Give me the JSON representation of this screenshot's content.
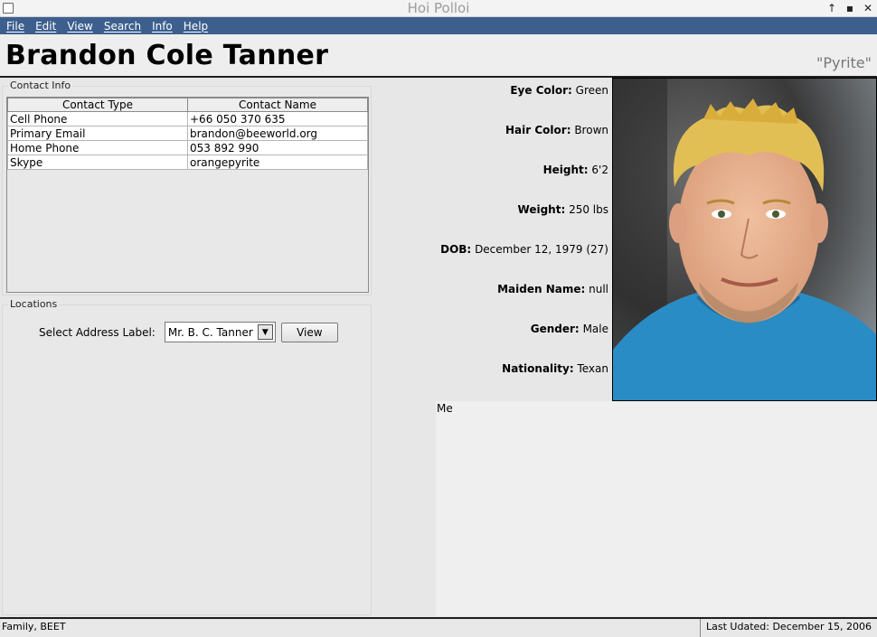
{
  "window": {
    "title": "Hoi Polloi",
    "controls": [
      "↑",
      "▪",
      "✕"
    ]
  },
  "menu": [
    "File",
    "Edit",
    "View",
    "Search",
    "Info",
    "Help"
  ],
  "header": {
    "name": "Brandon Cole Tanner",
    "nickname": "\"Pyrite\""
  },
  "contact_panel": {
    "legend": "Contact Info",
    "columns": [
      "Contact Type",
      "Contact Name"
    ],
    "rows": [
      [
        "Cell Phone",
        "+66 050 370 635"
      ],
      [
        "Primary Email",
        "brandon@beeworld.org"
      ],
      [
        "Home Phone",
        "053 892 990"
      ],
      [
        "Skype",
        "orangepyrite"
      ]
    ]
  },
  "locations_panel": {
    "legend": "Locations",
    "select_label": "Select Address Label:",
    "selected_address": "Mr. B. C. Tanner",
    "view_button": "View"
  },
  "attributes": [
    {
      "label": "Eye Color:",
      "value": "Green"
    },
    {
      "label": "Hair Color:",
      "value": "Brown"
    },
    {
      "label": "Height:",
      "value": "6'2"
    },
    {
      "label": "Weight:",
      "value": "250 lbs"
    },
    {
      "label": "DOB:",
      "value": "December 12, 1979 (27)"
    },
    {
      "label": "Maiden Name:",
      "value": "null"
    },
    {
      "label": "Gender:",
      "value": "Male"
    },
    {
      "label": "Nationality:",
      "value": "Texan"
    }
  ],
  "notes": "Me",
  "status": {
    "left": "Family, BEET",
    "right": "Last Udated: December 15, 2006"
  },
  "colors": {
    "menubar": "#3c5f8e",
    "shirt": "#2a8cc4",
    "hair": "#e2bf55",
    "skin": "#e9b18e"
  }
}
